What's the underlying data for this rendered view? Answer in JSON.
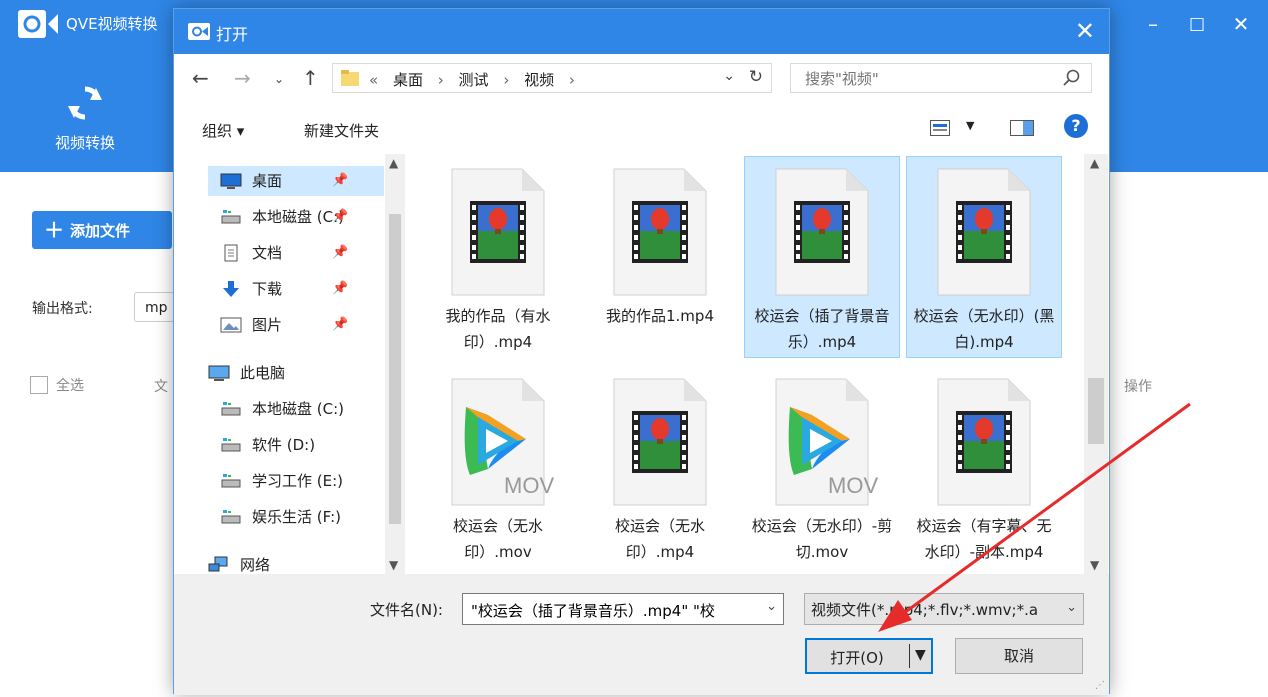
{
  "app": {
    "title": "QVE视频转换",
    "nav_convert": "视频转换",
    "add_file": "添加文件",
    "output_format_label": "输出格式:",
    "output_format_value": "mp",
    "select_all": "全选",
    "col_file": "文",
    "col_operation": "操作",
    "window_min": "–",
    "window_max": "□",
    "window_close": "✕"
  },
  "dialog": {
    "title": "打开",
    "close": "✕",
    "breadcrumb": [
      "«",
      "桌面",
      "›",
      "测试",
      "›",
      "视频",
      "›"
    ],
    "search_placeholder": "搜索\"视频\"",
    "toolbar": {
      "organize": "组织 ▾",
      "new_folder": "新建文件夹"
    },
    "nav_items": [
      {
        "label": "桌面",
        "icon": "desktop-icon",
        "pinned": true,
        "selected": true
      },
      {
        "label": "本地磁盘 (C:)",
        "icon": "drive-icon",
        "pinned": true
      },
      {
        "label": "文档",
        "icon": "document-icon",
        "pinned": true
      },
      {
        "label": "下载",
        "icon": "download-icon",
        "pinned": true
      },
      {
        "label": "图片",
        "icon": "picture-icon",
        "pinned": true
      },
      {
        "label": "此电脑",
        "icon": "computer-icon",
        "pinned": false
      },
      {
        "label": "本地磁盘 (C:)",
        "icon": "drive-icon",
        "pinned": false
      },
      {
        "label": "软件 (D:)",
        "icon": "drive-icon",
        "pinned": false
      },
      {
        "label": "学习工作 (E:)",
        "icon": "drive-icon",
        "pinned": false
      },
      {
        "label": "娱乐生活 (F:)",
        "icon": "drive-icon",
        "pinned": false
      },
      {
        "label": "网络",
        "icon": "network-icon",
        "pinned": false
      }
    ],
    "files": [
      {
        "name": "我的作品（有水印）.mp4",
        "kind": "mp4",
        "selected": false
      },
      {
        "name": "我的作品1.mp4",
        "kind": "mp4",
        "selected": false
      },
      {
        "name": "校运会（插了背景音乐）.mp4",
        "kind": "mp4",
        "selected": true
      },
      {
        "name": "校运会（无水印）(黑白).mp4",
        "kind": "mp4",
        "selected": true
      },
      {
        "name": "校运会（无水印）.mov",
        "kind": "mov",
        "selected": false
      },
      {
        "name": "校运会（无水印）.mp4",
        "kind": "mp4",
        "selected": false
      },
      {
        "name": "校运会（无水印）-剪切.mov",
        "kind": "mov",
        "selected": false
      },
      {
        "name": "校运会（有字幕、无水印）-副本.mp4",
        "kind": "mp4",
        "selected": false
      }
    ],
    "mov_badge": "MOV",
    "filename_label": "文件名(N):",
    "filename_value": "\"校运会（插了背景音乐）.mp4\" \"校",
    "filetype_value": "视频文件(*.mp4;*.flv;*.wmv;*.a",
    "open_button": "打开(O)",
    "cancel_button": "取消",
    "pin_glyph": "📌"
  },
  "colors": {
    "accent": "#2f86e6",
    "selection": "#cde8ff",
    "arrow": "#e62b2b"
  }
}
